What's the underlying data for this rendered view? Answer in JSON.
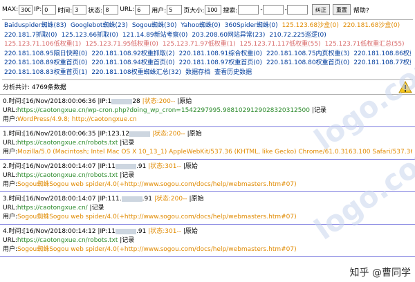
{
  "filters": {
    "max_label": "MAX:",
    "max_value": "300",
    "ip_label": "IP:",
    "ip_value": "0",
    "time_label": "时间:",
    "time_value": "3",
    "status_label": "状态:",
    "status_value": "8",
    "url_label": "URL:",
    "url_value": "6",
    "user_label": "用户:",
    "user_value": "5",
    "pagesize_label": "页大小:",
    "pagesize_value": "100",
    "search_label": "搜索:",
    "search1": "",
    "search2": "",
    "search3": "",
    "correct_btn": "纠正",
    "reset_btn": "重置",
    "help": "帮助?"
  },
  "links": [
    [
      {
        "t": "Baiduspider蜘蛛(83)",
        "c": "blue"
      },
      {
        "t": "Googlebot蜘蛛(23)",
        "c": "blue"
      },
      {
        "t": "Sogou蜘蛛(30)",
        "c": "blue"
      },
      {
        "t": "Yahoo蜘蛛(0)",
        "c": "blue"
      },
      {
        "t": "360Spider蜘蛛(0)",
        "c": "blue"
      },
      {
        "t": "125.123.68沙盒(0)",
        "c": "orange"
      },
      {
        "t": "220.181.68沙盒(0)",
        "c": "orange"
      }
    ],
    [
      {
        "t": "220.181.7抓取(0)",
        "c": "blue"
      },
      {
        "t": "125.123.66抓取(0)",
        "c": "blue"
      },
      {
        "t": "121.14.89新站考察(0)",
        "c": "blue"
      },
      {
        "t": "203.208.60网站异常(23)",
        "c": "blue"
      },
      {
        "t": "210.72.225巡逻(0)",
        "c": "blue"
      }
    ],
    [
      {
        "t": "125.123.71.106低权重(1)",
        "c": "pink"
      },
      {
        "t": "125.123.71.95低权重(0)",
        "c": "pink"
      },
      {
        "t": "125.123.71.97低权重(1)",
        "c": "pink"
      },
      {
        "t": "125.123.71.117低权重(55)",
        "c": "pink"
      },
      {
        "t": "125.123.71低权重汇总(55)",
        "c": "pink"
      }
    ],
    [
      {
        "t": "220.181.108.95隔日快照(0)",
        "c": "blue"
      },
      {
        "t": "220.181.108.92权重抓取(2)",
        "c": "blue"
      },
      {
        "t": "220.181.108.91综合权重(0)",
        "c": "blue"
      },
      {
        "t": "220.181.108.75内页权重(3)",
        "c": "blue"
      },
      {
        "t": "220.181.108.86权重首页(0)",
        "c": "blue"
      }
    ],
    [
      {
        "t": "220.181.108.89权重首页(0)",
        "c": "blue"
      },
      {
        "t": "220.181.108.94权重首页(0)",
        "c": "blue"
      },
      {
        "t": "220.181.108.97权重首页(0)",
        "c": "blue"
      },
      {
        "t": "220.181.108.80权重首页(0)",
        "c": "blue"
      },
      {
        "t": "220.181.108.77权重首页(0)",
        "c": "blue"
      }
    ],
    [
      {
        "t": "220.181.108.83权重首页(1)",
        "c": "blue"
      },
      {
        "t": "220.181.108权重蜘蛛汇总(32)",
        "c": "blue"
      },
      {
        "t": "数据存档",
        "c": "blue"
      },
      {
        "t": "查看历史数据",
        "c": "blue"
      }
    ]
  ],
  "summary": "分析共计: 4769条数据",
  "records": [
    {
      "head": "0.时间:[16/Nov/2018:00:06:36 |IP:1",
      "ip_tail": "28",
      "status": "|状态:200--",
      "tail": "|原始",
      "url_label": "URL:",
      "url": "https://caotongxue.cn/wp-cron.php?doing_wp_cron=1542297995.9881029129028320312500",
      "url_tail": " |记录",
      "ua_label": "用户:",
      "ua": "WordPress/4.9.8; http://caotongxue.cn"
    },
    {
      "head": "1.时间:[16/Nov/2018:00:06:35 |IP:123.12",
      "ip_tail": "",
      "status": "|状态:200--",
      "tail": "|原始",
      "url_label": "URL:",
      "url": "https://caotongxue.cn/robots.txt",
      "url_tail": " |记录",
      "ua_label": "用户:",
      "ua": "Mozilla/5.0 (Macintosh; Intel Mac OS X 10_13_1) AppleWebKit/537.36 (KHTML, like Gecko) Chrome/61.0.3163.100 Safari/537.36"
    },
    {
      "head": "2.时间:[16/Nov/2018:00:14:07 |IP:11",
      "ip_tail": ".91",
      "status": "|状态:301--",
      "tail": "|原始",
      "url_label": "URL:",
      "url": "https://caotongxue.cn/robots.txt",
      "url_tail": " |记录",
      "ua_label": "用户:",
      "ua": "Sogou蜘蛛Sogou web spider/4.0(+http://www.sogou.com/docs/help/webmasters.htm#07)"
    },
    {
      "head": "3.时间:[16/Nov/2018:00:14:07 |IP:111.",
      "ip_tail": ".91",
      "status": "|状态:200--",
      "tail": "|原始",
      "url_label": "URL:",
      "url": "https://caotongxue.cn/",
      "url_tail": " |记录",
      "ua_label": "用户:",
      "ua": "Sogou蜘蛛Sogou web spider/4.0(+http://www.sogou.com/docs/help/webmasters.htm#07)"
    },
    {
      "head": "4.时间:[16/Nov/2018:00:14:12 |IP:11",
      "ip_tail": ".91",
      "status": "|状态:301--",
      "tail": "|原始",
      "url_label": "URL:",
      "url": "https://caotongxue.cn/robots.txt",
      "url_tail": " |记录",
      "ua_label": "用户:",
      "ua": "Sogou蜘蛛Sogou web spider/4.0(+http://www.sogou.com/docs/help/webmasters.htm#07)"
    }
  ],
  "watermark": "logo.com",
  "credit": "知乎 @曹同学",
  "colors": {
    "link_blue": "#003c9c",
    "orange": "#e08a00",
    "pink": "#d86a6a",
    "url_green": "#2b8a2b",
    "divider": "#7a7adf"
  },
  "icons": {
    "warning": "warning-icon"
  }
}
